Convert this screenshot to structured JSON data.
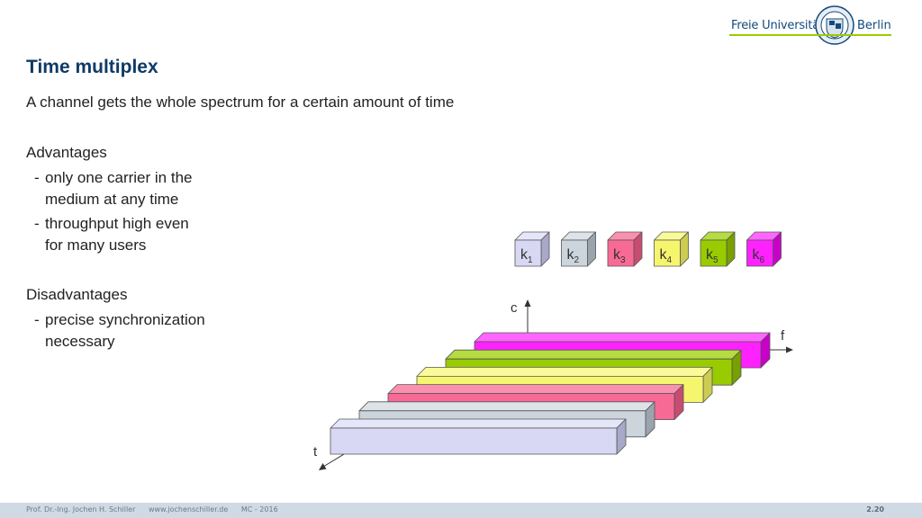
{
  "header": {
    "logo": {
      "left_text": "Freie Universität",
      "right_text": "Berlin"
    }
  },
  "title": "Time multiplex",
  "subtitle": "A channel gets the whole spectrum for a certain amount of time",
  "advantages": {
    "heading": "Advantages",
    "items": [
      {
        "line1": "only one carrier in the",
        "line2": "medium at any time"
      },
      {
        "line1": "throughput high even",
        "line2": "for many users"
      }
    ]
  },
  "disadvantages": {
    "heading": "Disadvantages",
    "items": [
      {
        "line1": "precise synchronization",
        "line2": "necessary"
      }
    ]
  },
  "diagram": {
    "axes": {
      "c": "c",
      "f": "f",
      "t": "t"
    },
    "channels": [
      {
        "label": "k",
        "sub": "1",
        "front": "#d8d8f4",
        "top": "#e6e6fa",
        "side": "#a8a8c8"
      },
      {
        "label": "k",
        "sub": "2",
        "front": "#ccd4dc",
        "top": "#dde3e9",
        "side": "#9aa4ae"
      },
      {
        "label": "k",
        "sub": "3",
        "front": "#f76a96",
        "top": "#fa8fb0",
        "side": "#c84c72"
      },
      {
        "label": "k",
        "sub": "4",
        "front": "#f6f66e",
        "top": "#fafa9a",
        "side": "#cccc50"
      },
      {
        "label": "k",
        "sub": "5",
        "front": "#99cc00",
        "top": "#b5dc40",
        "side": "#78a000"
      },
      {
        "label": "k",
        "sub": "6",
        "front": "#ff22ff",
        "top": "#ff66ff",
        "side": "#c800c8"
      }
    ]
  },
  "footer": {
    "author": "Prof. Dr.-Ing. Jochen H. Schiller",
    "website": "www.jochenschiller.de",
    "course": "MC - 2016",
    "page": "2.20"
  }
}
